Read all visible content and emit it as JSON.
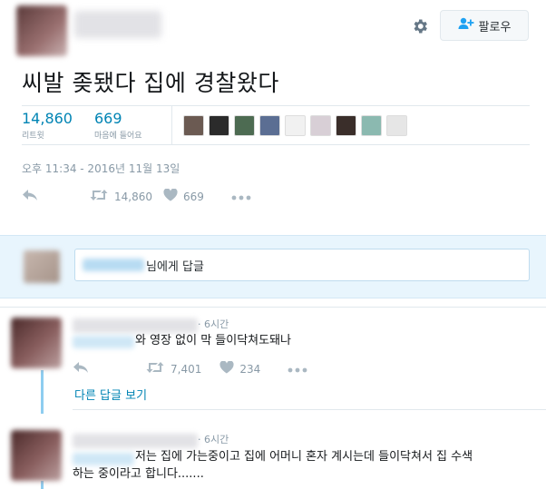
{
  "header": {
    "follow_label": "팔로우"
  },
  "tweet": {
    "text": "씨발 좆됐다 집에 경찰왔다",
    "retweets": "14,860",
    "retweets_label": "리트윗",
    "likes": "669",
    "likes_label": "마음에 들어요",
    "datetime": "오후 11:34 - 2016년 11월 13일",
    "action_retweets": "14,860",
    "action_likes": "669"
  },
  "likers_colors": [
    "#6b5a52",
    "#2b2b2b",
    "#4d6b52",
    "#5b6e93",
    "#f1f1f1",
    "#d8cfd6",
    "#3a2e2a",
    "#8bb9b0",
    "#e6e6e6"
  ],
  "reply_box": {
    "placeholder_suffix": "님에게 답글"
  },
  "replies": [
    {
      "time": "· 6시간",
      "text": "와 영장 없이 막 들이닥쳐도돼나",
      "retweets": "7,401",
      "likes": "234"
    },
    {
      "time": "· 6시간",
      "text_line1": "저는 집에 가는중이고 집에 어머니 혼자 계시는데 들이닥쳐서 집 수색",
      "text_line2": "하는 중이라고 합니다......."
    }
  ],
  "more_replies_label": "다른 답글 보기"
}
